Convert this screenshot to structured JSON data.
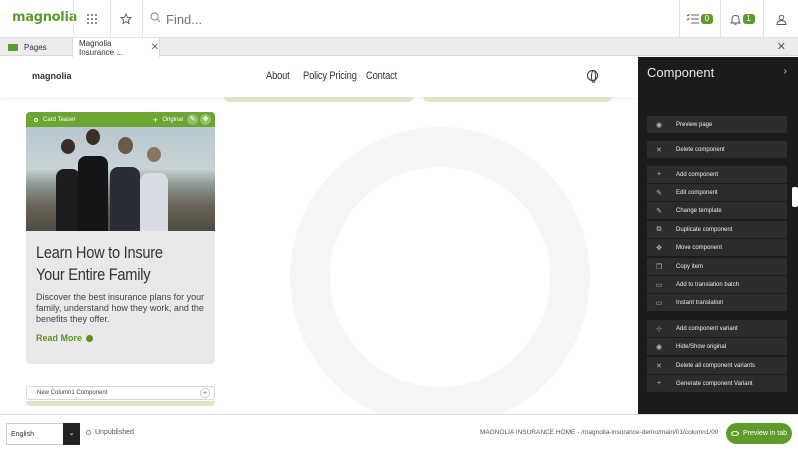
{
  "topbar": {
    "logo": "magnolia",
    "search_placeholder": "Find...",
    "tasks_count": "0",
    "notifications_count": "1"
  },
  "tabs": [
    {
      "label": "Pages"
    },
    {
      "label": "Magnolia Insurance ..."
    }
  ],
  "site": {
    "logo": "magnolia",
    "nav": [
      "About",
      "Policy Pricing",
      "Contact"
    ]
  },
  "card": {
    "toolbar_label": "Card Teaser",
    "toolbar_original": "Original",
    "title": "Learn How to Insure Your Entire Family",
    "description": "Discover the best insurance plans for your family, understand how they work, and the benefits they offer.",
    "read_more": "Read More"
  },
  "new_column": {
    "label": "New Column1 Component"
  },
  "panel": {
    "title": "Component",
    "actions": [
      {
        "label": "Preview page",
        "icon": "eye-icon"
      },
      {
        "label": "Delete component",
        "icon": "close-icon"
      },
      {
        "label": "Add component",
        "icon": "plus-icon"
      },
      {
        "label": "Edit component",
        "icon": "pencil-icon"
      },
      {
        "label": "Change template",
        "icon": "pencil-icon"
      },
      {
        "label": "Duplicate component",
        "icon": "duplicate-icon"
      },
      {
        "label": "Move component",
        "icon": "move-icon"
      },
      {
        "label": "Copy item",
        "icon": "copy-icon"
      },
      {
        "label": "Add to translation batch",
        "icon": "translate-icon"
      },
      {
        "label": "Instant translation",
        "icon": "translate-icon"
      },
      {
        "label": "Add component variant",
        "icon": "variant-add-icon"
      },
      {
        "label": "Hide/Show original",
        "icon": "eye-icon"
      },
      {
        "label": "Delete all component variants",
        "icon": "close-icon"
      },
      {
        "label": "Generate component Variant",
        "icon": "plus-icon"
      }
    ]
  },
  "footer": {
    "language": "English",
    "status": "Unpublished",
    "path": "MAGNOLIA INSURANCE HOME - /magnolia-insurance-demo/main/01/column1/00",
    "preview_button": "Preview in tab"
  },
  "colors": {
    "brand_green": "#5f9b2b",
    "panel_bg": "#1b1b1b"
  }
}
